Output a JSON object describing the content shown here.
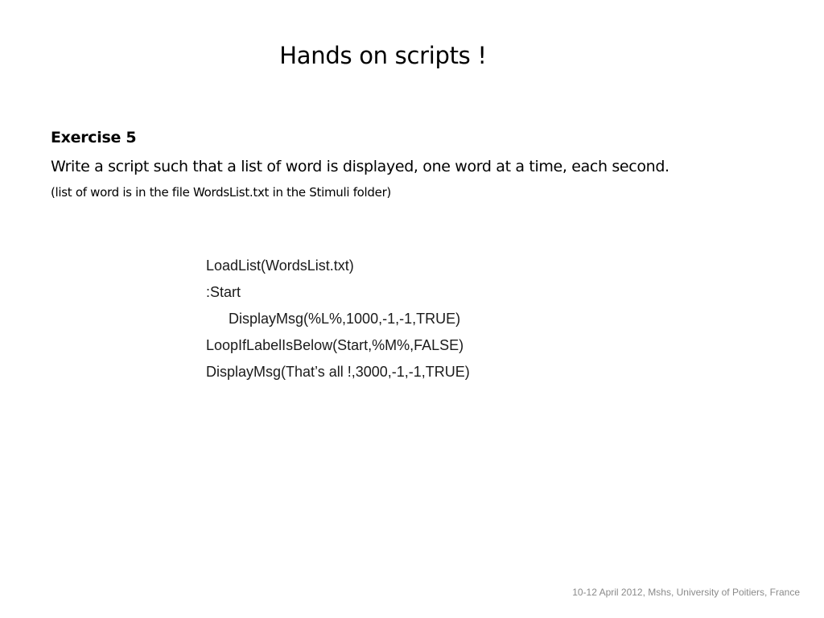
{
  "slide": {
    "title": "Hands on scripts !",
    "exercise_heading": "Exercise 5",
    "exercise_description": "Write a script such that a list of word is displayed, one word at a time, each second.",
    "exercise_note": "(list of word is in the file WordsList.txt in the Stimuli folder)",
    "code_lines": [
      "LoadList(WordsList.txt)",
      ":Start",
      "DisplayMsg(%L%,1000,-1,-1,TRUE)",
      "LoopIfLabelIsBelow(Start,%M%,FALSE)",
      "DisplayMsg(That’s all !,3000,-1,-1,TRUE)"
    ],
    "footer": "10-12 April 2012, Mshs, University of Poitiers, France"
  }
}
